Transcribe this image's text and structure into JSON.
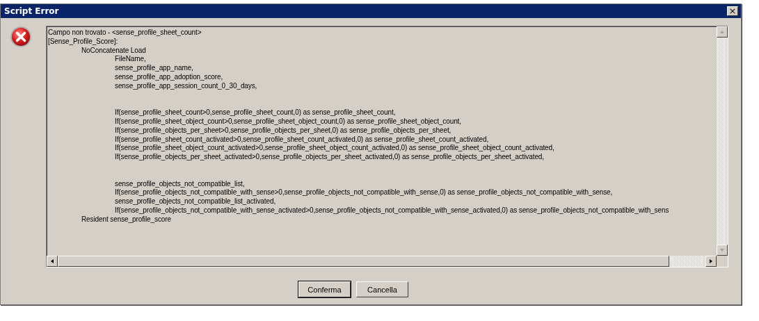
{
  "window": {
    "title": "Script Error",
    "close": "×"
  },
  "message": "Campo non trovato - <sense_profile_sheet_count>\n[Sense_Profile_Score]:\n\tNoConcatenate Load\n\t\tFileName,\n\t\tsense_profile_app_name,\n\t\tsense_profile_app_adoption_score,\n\t\tsense_profile_app_session_count_0_30_days,\n\n\n\t\tIf(sense_profile_sheet_count>0,sense_profile_sheet_count,0) as sense_profile_sheet_count,\n\t\tIf(sense_profile_sheet_object_count>0,sense_profile_sheet_object_count,0) as sense_profile_sheet_object_count,\n\t\tIf(sense_profile_objects_per_sheet>0,sense_profile_objects_per_sheet,0) as sense_profile_objects_per_sheet,\n\t\tIf(sense_profile_sheet_count_activated>0,sense_profile_sheet_count_activated,0) as sense_profile_sheet_count_activated,\n\t\tIf(sense_profile_sheet_object_count_activated>0,sense_profile_sheet_object_count_activated,0) as sense_profile_sheet_object_count_activated,\n\t\tIf(sense_profile_objects_per_sheet_activated>0,sense_profile_objects_per_sheet_activated,0) as sense_profile_objects_per_sheet_activated,\n\n\n\t\tsense_profile_objects_not_compatible_list,\n\t\tIf(sense_profile_objects_not_compatible_with_sense>0,sense_profile_objects_not_compatible_with_sense,0) as sense_profile_objects_not_compatible_with_sense,\n\t\tsense_profile_objects_not_compatible_list_activated,\n\t\tIf(sense_profile_objects_not_compatible_with_sense_activated>0,sense_profile_objects_not_compatible_with_sense_activated,0) as sense_profile_objects_not_compatible_with_sens\n\tResident sense_profile_score",
  "buttons": [
    {
      "label": "Conferma",
      "selected": true
    },
    {
      "label": "Cancella",
      "selected": false
    }
  ]
}
